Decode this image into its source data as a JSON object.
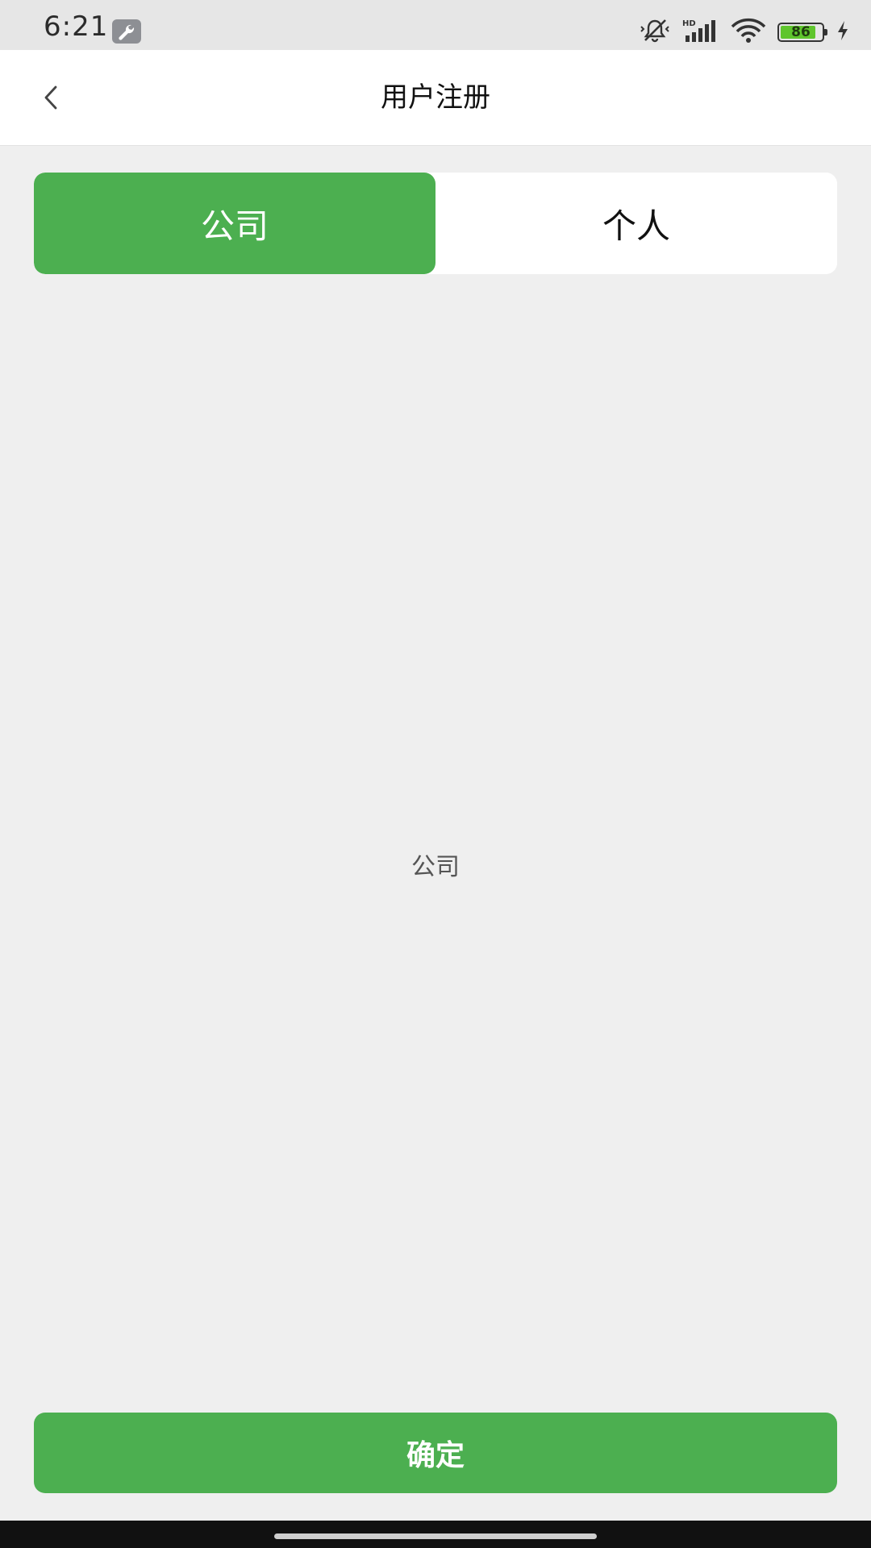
{
  "status_bar": {
    "time": "6:21",
    "network_label": "HD",
    "battery_level": "86",
    "battery_fraction": 0.86,
    "icons": [
      "wrench-icon",
      "mute-vibrate-icon",
      "signal-icon",
      "wifi-icon",
      "battery-icon",
      "charging-icon"
    ]
  },
  "nav": {
    "title": "用户注册",
    "back_icon": "chevron-left-icon"
  },
  "tabs": [
    {
      "label": "公司",
      "active": true
    },
    {
      "label": "个人",
      "active": false
    }
  ],
  "content": {
    "label": "公司"
  },
  "confirm_label": "确定",
  "colors": {
    "accent": "#4caf50",
    "background": "#efefef",
    "header": "#ffffff"
  }
}
